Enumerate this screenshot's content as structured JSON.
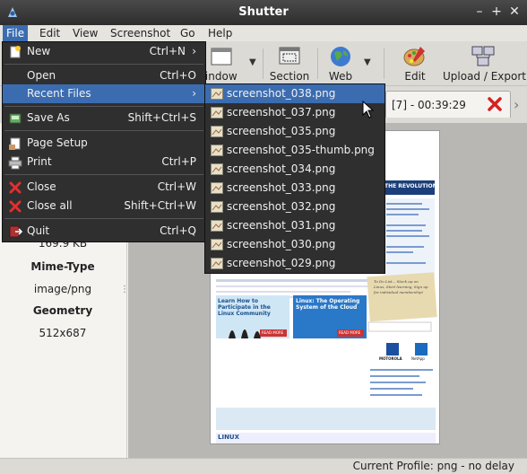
{
  "window": {
    "title": "Shutter",
    "controls": {
      "minimize": "–",
      "maximize": "+",
      "close": "✕"
    }
  },
  "menubar": {
    "items": [
      "File",
      "Edit",
      "View",
      "Screenshot",
      "Go",
      "Help"
    ],
    "active": "File"
  },
  "toolbar": {
    "window_label": "Window",
    "section_label": "Section",
    "web_label": "Web",
    "edit_label": "Edit",
    "upload_label": "Upload / Export"
  },
  "tab": {
    "label": "[7] - 00:39:29"
  },
  "sidebar": {
    "size_value": "169.9 KB",
    "mime_label": "Mime-Type",
    "mime_value": "image/png",
    "geometry_label": "Geometry",
    "geometry_value": "512x687"
  },
  "file_menu": {
    "items": [
      {
        "label": "New",
        "shortcut": "Ctrl+N",
        "icon": "new-icon",
        "submenu": true
      },
      {
        "label": "Open",
        "shortcut": "Ctrl+O",
        "icon": "open-icon"
      },
      {
        "label": "Recent Files",
        "shortcut": "",
        "icon": "",
        "submenu": true
      },
      {
        "label": "Save As",
        "shortcut": "Shift+Ctrl+S",
        "icon": "save-as-icon"
      },
      {
        "label": "Page Setup",
        "shortcut": "",
        "icon": "page-setup-icon"
      },
      {
        "label": "Print",
        "shortcut": "Ctrl+P",
        "icon": "print-icon"
      },
      {
        "label": "Close",
        "shortcut": "Ctrl+W",
        "icon": "close-icon"
      },
      {
        "label": "Close all",
        "shortcut": "Shift+Ctrl+W",
        "icon": "close-all-icon"
      },
      {
        "label": "Quit",
        "shortcut": "Ctrl+Q",
        "icon": "quit-icon"
      }
    ],
    "arrow": "›"
  },
  "recent_files": [
    "screenshot_038.png",
    "screenshot_037.png",
    "screenshot_035.png",
    "screenshot_035-thumb.png",
    "screenshot_034.png",
    "screenshot_033.png",
    "screenshot_032.png",
    "screenshot_031.png",
    "screenshot_030.png",
    "screenshot_029.png"
  ],
  "preview": {
    "banner_text": "THE REVOLUTION",
    "ad1_text": "Learn How to Participate in the Linux Community",
    "ad1_cta": "READ MORE",
    "ad2_text": "Linux: The Operating System of the Cloud",
    "ad2_cta": "READ MORE",
    "note_text": "To Do List... Stock up on Linux, Start learning, Sign up for individual membership!",
    "brand1": "MOTOROLA",
    "brand2": "NetApp",
    "footer_logo": "LINUX"
  },
  "statusbar": {
    "text": "Current Profile: png - no delay"
  }
}
